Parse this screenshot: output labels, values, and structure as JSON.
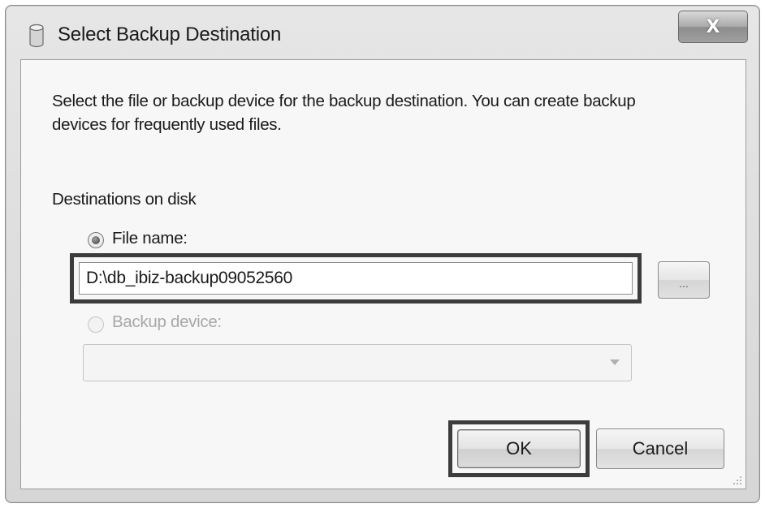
{
  "window": {
    "title": "Select Backup Destination",
    "close_glyph": "X",
    "icon": "database-icon"
  },
  "content": {
    "description": "Select the file or backup device for the backup destination. You can create backup devices for frequently used files.",
    "group_label": "Destinations on disk"
  },
  "file_name_option": {
    "label": "File name:",
    "selected": true,
    "value": "D:\\db_ibiz-backup09052560"
  },
  "browse_button": {
    "label": "..."
  },
  "backup_device_option": {
    "label": "Backup device:",
    "selected": false,
    "enabled": false,
    "selected_value": ""
  },
  "buttons": {
    "ok_label": "OK",
    "cancel_label": "Cancel"
  },
  "colors": {
    "highlight_border": "#3c3c3c",
    "disabled_text": "#a8a8a8"
  }
}
